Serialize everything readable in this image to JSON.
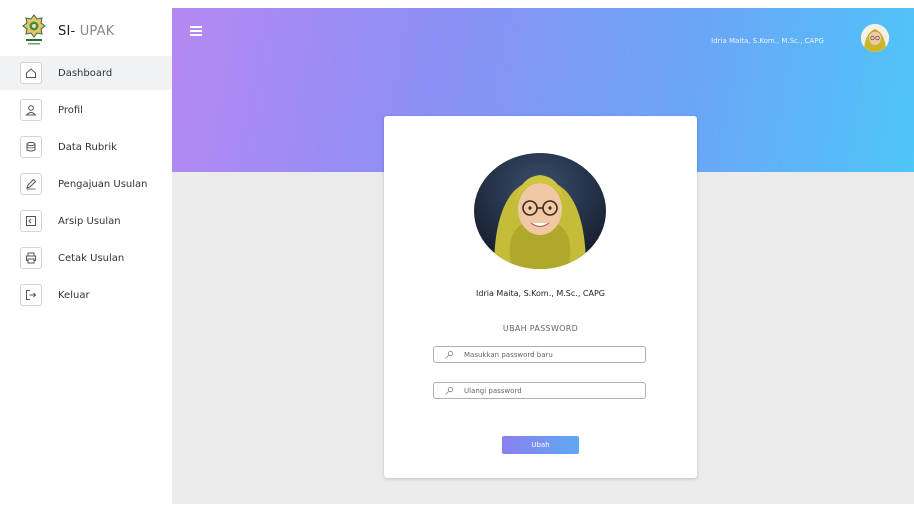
{
  "brand": {
    "title_prefix": "SI- ",
    "title_suffix": "UPAK",
    "logo_icon": "university-logo"
  },
  "sidebar": {
    "items": [
      {
        "label": "Dashboard",
        "icon": "home-icon",
        "active": true
      },
      {
        "label": "Profil",
        "icon": "user-icon",
        "active": false
      },
      {
        "label": "Data Rubrik",
        "icon": "database-icon",
        "active": false
      },
      {
        "label": "Pengajuan Usulan",
        "icon": "pencil-icon",
        "active": false
      },
      {
        "label": "Arsip Usulan",
        "icon": "archive-icon",
        "active": false
      },
      {
        "label": "Cetak Usulan",
        "icon": "printer-icon",
        "active": false
      },
      {
        "label": "Keluar",
        "icon": "logout-icon",
        "active": false
      }
    ]
  },
  "header": {
    "menu_icon": "hamburger-icon",
    "user_name": "Idria Maita, S.Kom., M.Sc., CAPG"
  },
  "card": {
    "profile_name": "Idria Maita, S.Kom., M.Sc., CAPG",
    "section_title": "UBAH PASSWORD",
    "new_password": {
      "placeholder": "Masukkan password baru",
      "value": ""
    },
    "confirm_password": {
      "placeholder": "Ulangi password",
      "value": ""
    },
    "submit_label": "Ubah"
  },
  "colors": {
    "header_gradient_start": "#b588f1",
    "header_gradient_end": "#4ec6f7",
    "content_bg": "#ebebeb",
    "button_start": "#8a7ff0",
    "button_end": "#5fa8f2"
  }
}
